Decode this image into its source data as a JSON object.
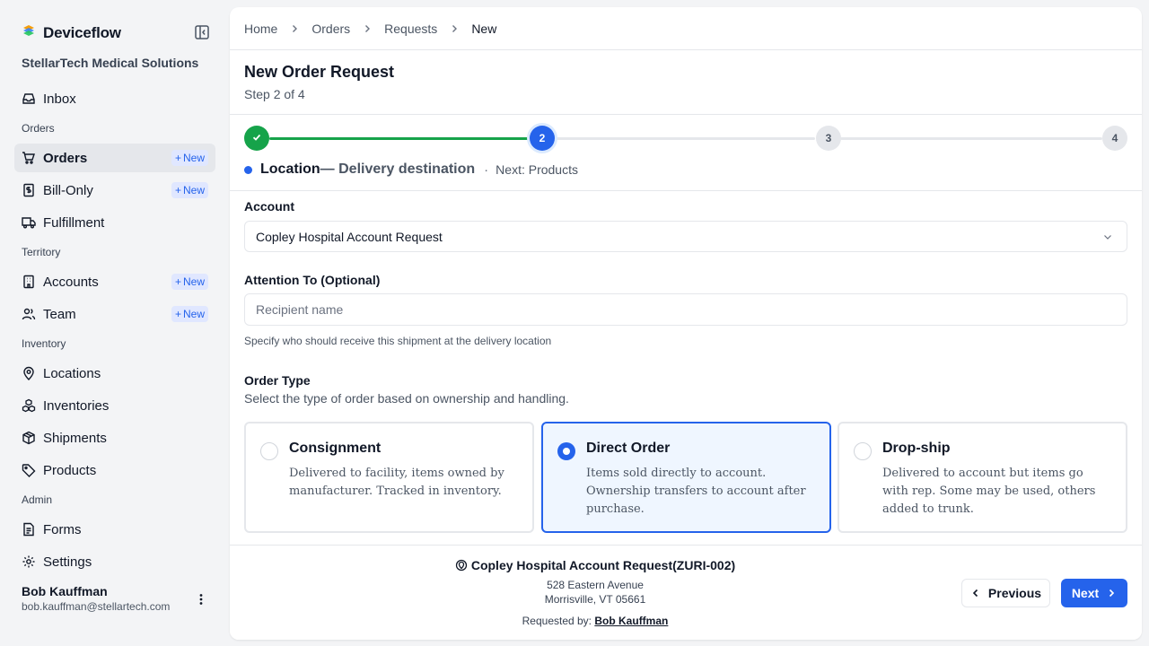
{
  "app": {
    "name": "Deviceflow",
    "org": "StellarTech Medical Solutions"
  },
  "sidebar": {
    "inbox": "Inbox",
    "sections": {
      "orders": "Orders",
      "territory": "Territory",
      "inventory": "Inventory",
      "admin": "Admin"
    },
    "items": {
      "orders": "Orders",
      "bill_only": "Bill-Only",
      "fulfillment": "Fulfillment",
      "accounts": "Accounts",
      "team": "Team",
      "locations": "Locations",
      "inventories": "Inventories",
      "shipments": "Shipments",
      "products": "Products",
      "forms": "Forms",
      "settings": "Settings"
    },
    "new_badge": "New"
  },
  "user": {
    "name": "Bob Kauffman",
    "email": "bob.kauffman@stellartech.com"
  },
  "breadcrumb": [
    "Home",
    "Orders",
    "Requests",
    "New"
  ],
  "page": {
    "title": "New Order Request",
    "step": "Step 2 of 4"
  },
  "stepper": {
    "steps": [
      "",
      "2",
      "3",
      "4"
    ],
    "current_name": "Location",
    "current_desc": "— Delivery destination",
    "sep": "·",
    "next": "Next: Products"
  },
  "form": {
    "account_label": "Account",
    "account_value": "Copley Hospital Account Request",
    "attention_label": "Attention To (Optional)",
    "attention_placeholder": "Recipient name",
    "attention_help": "Specify who should receive this shipment at the delivery location",
    "order_type_label": "Order Type",
    "order_type_help": "Select the type of order based on ownership and handling.",
    "order_types": [
      {
        "title": "Consignment",
        "desc": "Delivered to facility, items owned by manufacturer. Tracked in inventory.",
        "selected": false
      },
      {
        "title": "Direct Order",
        "desc": "Items sold directly to account. Ownership transfers to account after purchase.",
        "selected": true
      },
      {
        "title": "Drop-ship",
        "desc": "Delivered to account but items go with rep. Some may be used, others added to trunk.",
        "selected": false
      }
    ]
  },
  "footer": {
    "account_name": "Copley Hospital Account Request(ZURI-002)",
    "address_line1": "528 Eastern Avenue",
    "address_line2": "Morrisville, VT 05661",
    "requested_by_label": "Requested by:",
    "requested_by": "Bob Kauffman",
    "prev_label": "Previous",
    "next_label": "Next"
  },
  "colors": {
    "accent": "#2563eb",
    "success": "#16a34a",
    "selected_bg": "#eff6ff"
  }
}
